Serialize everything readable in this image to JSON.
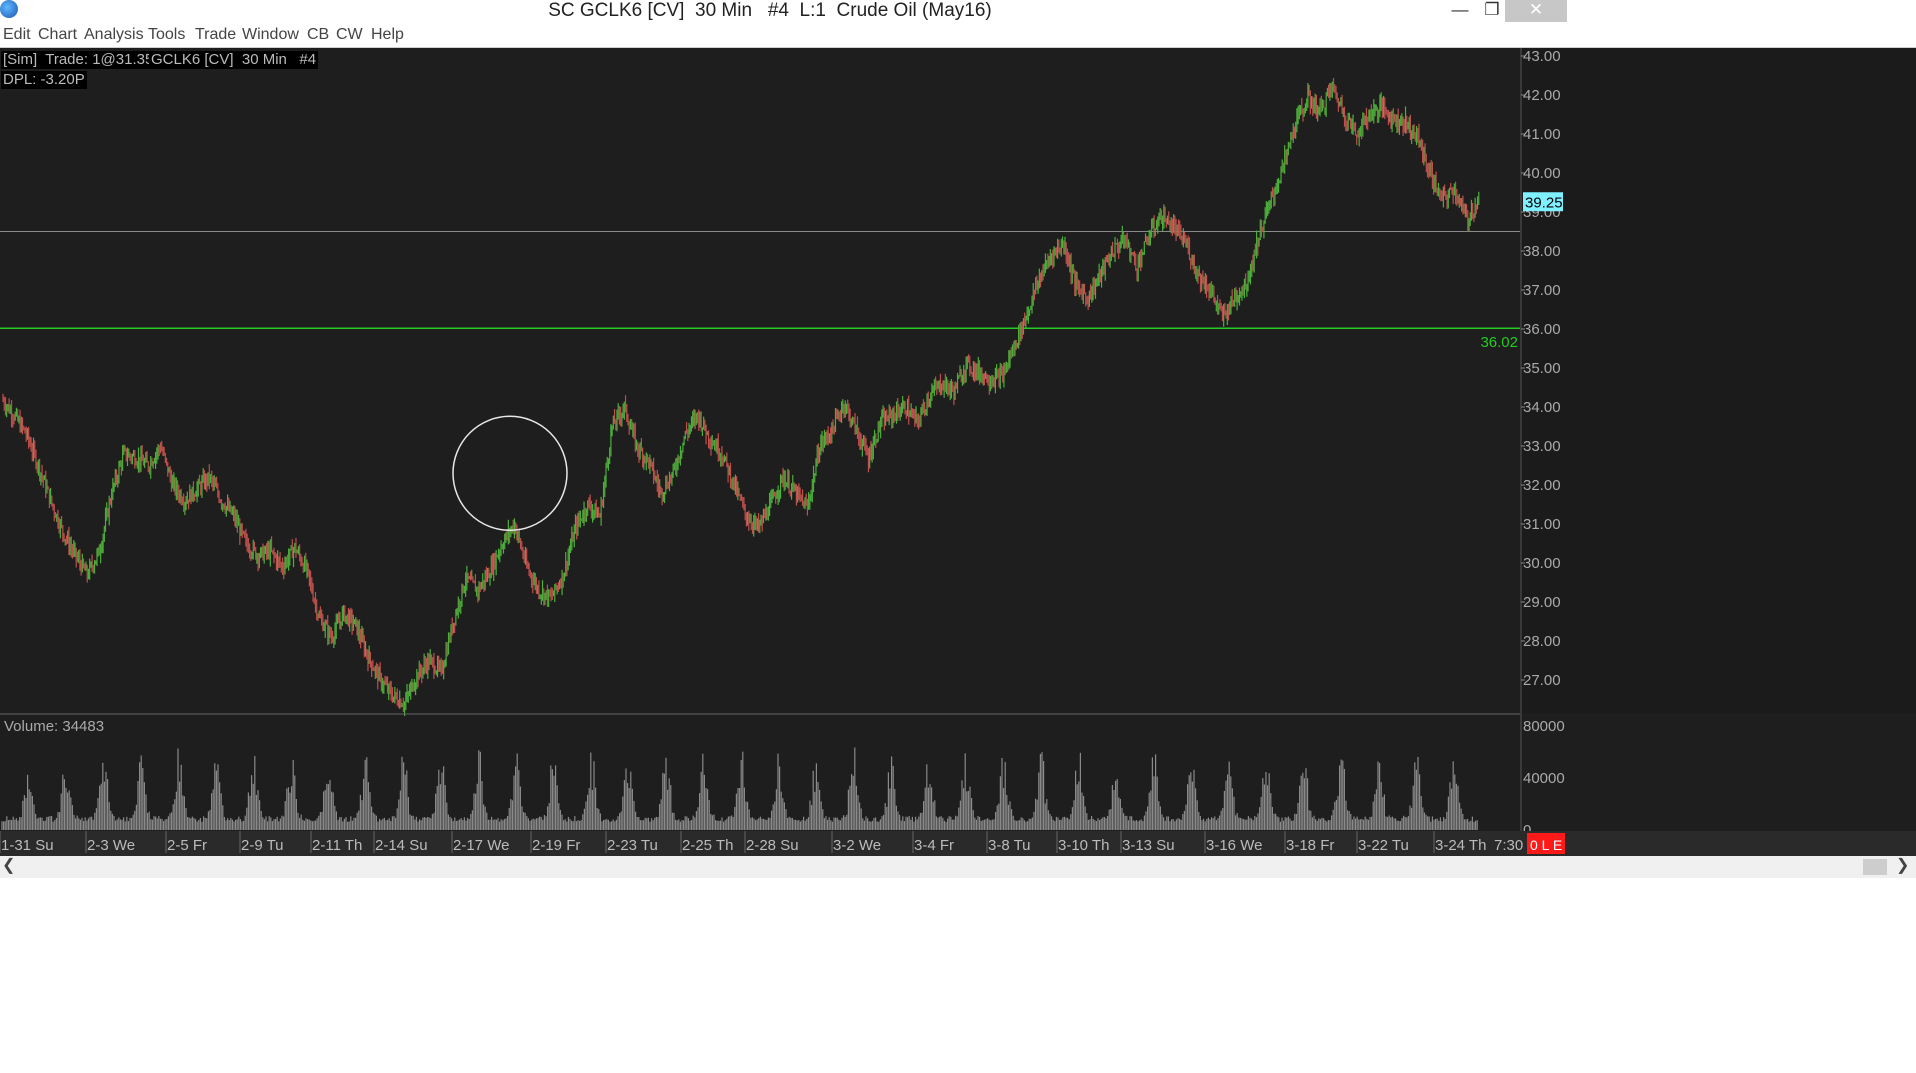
{
  "window": {
    "title": "SC GCLK6 [CV]  30 Min   #4  L:1  Crude Oil (May16)",
    "minimize_glyph": "—",
    "restore_glyph": "❐",
    "close_glyph": "✕"
  },
  "menu": [
    "Edit",
    "Chart",
    "Analysis",
    "Tools",
    "Trade",
    "Window",
    "CB",
    "CW",
    "Help"
  ],
  "chart": {
    "header_sim": "[Sim]  Trade: 1@31.35",
    "header_symbol": "GCLK6 [CV]  30 Min   #4",
    "dpl": "DPL: -3.20P",
    "volume_label": "Volume: 34483",
    "last_price": "39.25",
    "hline_label": "36.02",
    "time_label": "7:30",
    "status_label": "0 L E",
    "colors": {
      "background": "#1e1e1e",
      "up_bar": "#4caf3a",
      "down_bar": "#c0504d",
      "hline": "#22cc22",
      "price_tag": "#7ff0ff",
      "status": "#ff1a1a"
    }
  },
  "chart_data": {
    "type": "line",
    "title": "",
    "xlabel": "",
    "ylabel": "",
    "ylim": [
      26.2,
      43.2
    ],
    "y_ticks": [
      "43.00",
      "42.00",
      "41.00",
      "40.00",
      "39.00",
      "38.00",
      "37.00",
      "36.00",
      "35.00",
      "34.00",
      "33.00",
      "32.00",
      "31.00",
      "30.00",
      "29.00",
      "28.00",
      "27.00"
    ],
    "x_tick_labels": [
      "1-31 Su",
      "2-3 We",
      "2-5 Fr",
      "2-9 Tu",
      "2-11 Th",
      "2-14 Su",
      "2-17 We",
      "2-19 Fr",
      "2-23 Tu",
      "2-25 Th",
      "2-28 Su",
      "3-2 We",
      "3-4 Fr",
      "3-8 Tu",
      "3-10 Th",
      "3-13 Su",
      "3-16 We",
      "3-18 Fr",
      "3-22 Tu",
      "3-24 Th"
    ],
    "horizontal_lines": [
      36.02,
      38.5
    ],
    "annotations": [
      {
        "type": "circle",
        "around_price": 32.3
      }
    ],
    "series": [
      {
        "values": [
          34.2,
          33.8,
          33.3,
          32.5,
          31.6,
          30.8,
          30.2,
          29.7,
          30.3,
          31.8,
          32.8,
          32.7,
          32.5,
          33.0,
          32.0,
          31.6,
          31.9,
          32.2,
          31.6,
          31.2,
          30.5,
          30.2,
          30.3,
          29.9,
          30.4,
          29.8,
          28.6,
          28.1,
          28.7,
          28.4,
          27.6,
          27.0,
          26.6,
          26.4,
          27.1,
          27.5,
          27.2,
          28.5,
          29.6,
          29.3,
          29.8,
          30.5,
          31.0,
          29.9,
          29.3,
          29.1,
          29.7,
          30.9,
          31.5,
          31.2,
          33.5,
          34.0,
          33.0,
          32.6,
          31.8,
          32.3,
          33.3,
          33.8,
          33.2,
          32.8,
          32.0,
          31.2,
          30.9,
          31.5,
          32.2,
          31.8,
          31.4,
          33.0,
          33.4,
          34.1,
          33.4,
          32.7,
          33.6,
          33.8,
          34.0,
          33.6,
          34.3,
          34.6,
          34.4,
          35.1,
          34.9,
          34.7,
          34.8,
          35.6,
          36.4,
          37.3,
          37.9,
          38.2,
          37.1,
          36.8,
          37.4,
          38.0,
          38.3,
          37.6,
          38.4,
          38.9,
          38.6,
          38.2,
          37.4,
          37.0,
          36.3,
          36.8,
          37.2,
          38.4,
          39.3,
          40.2,
          41.3,
          41.9,
          41.6,
          42.2,
          41.5,
          41.0,
          41.5,
          41.7,
          41.4,
          41.3,
          40.9,
          40.0,
          39.3,
          39.6,
          38.8,
          39.3
        ]
      }
    ]
  },
  "volume_data": {
    "axis_labels": [
      "80000",
      "40000",
      "0"
    ],
    "ylim": [
      0,
      100000
    ]
  }
}
